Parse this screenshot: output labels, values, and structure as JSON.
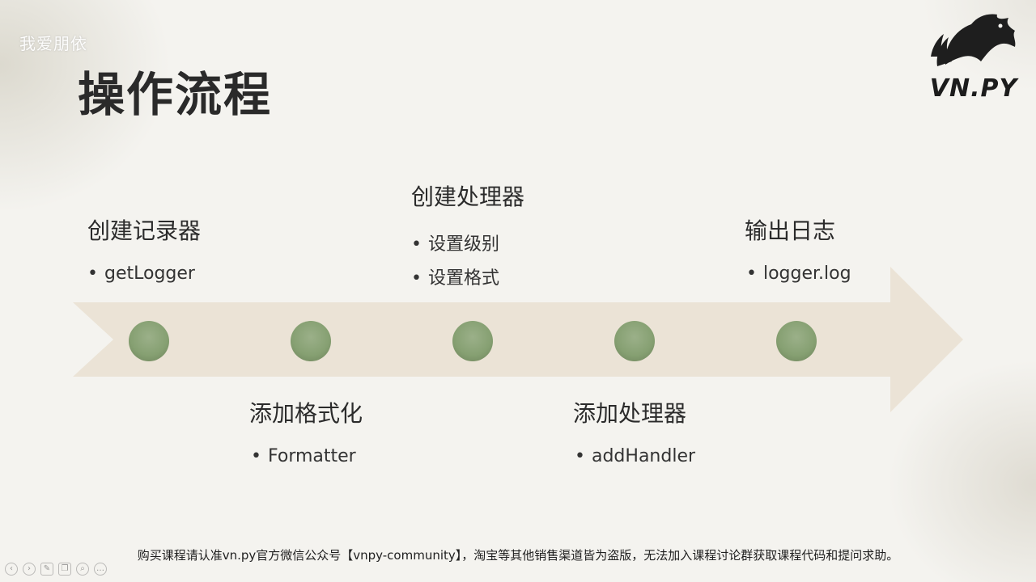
{
  "watermark": "我爱朋依",
  "slide": {
    "title": "操作流程",
    "logo_text": "VN.PY",
    "logo_icon": "horse-head-icon"
  },
  "steps": [
    {
      "title": "创建记录器",
      "bullets": [
        "getLogger"
      ]
    },
    {
      "title": "添加格式化",
      "bullets": [
        "Formatter"
      ]
    },
    {
      "title": "创建处理器",
      "bullets": [
        "设置级别",
        "设置格式"
      ]
    },
    {
      "title": "添加处理器",
      "bullets": [
        "addHandler"
      ]
    },
    {
      "title": "输出日志",
      "bullets": [
        "logger.log"
      ]
    }
  ],
  "footer": "购买课程请认准vn.py官方微信公众号【vnpy-community】，淘宝等其他销售渠道皆为盗版，无法加入课程讨论群获取课程代码和提问求助。",
  "colors": {
    "arrow": "#ebe3d6",
    "node": "#8da27a",
    "background": "#f4f3ef"
  },
  "toolbar_icons": [
    "prev-icon",
    "next-icon",
    "pen-icon",
    "copy-icon",
    "search-icon",
    "more-icon"
  ]
}
